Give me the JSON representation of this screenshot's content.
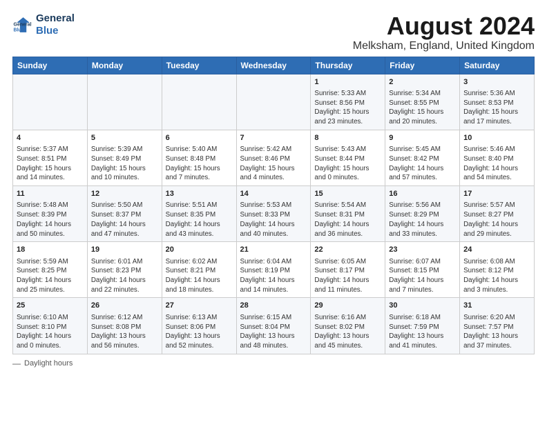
{
  "header": {
    "logo_line1": "General",
    "logo_line2": "Blue",
    "main_title": "August 2024",
    "subtitle": "Melksham, England, United Kingdom"
  },
  "columns": [
    "Sunday",
    "Monday",
    "Tuesday",
    "Wednesday",
    "Thursday",
    "Friday",
    "Saturday"
  ],
  "weeks": [
    [
      {
        "day": "",
        "content": ""
      },
      {
        "day": "",
        "content": ""
      },
      {
        "day": "",
        "content": ""
      },
      {
        "day": "",
        "content": ""
      },
      {
        "day": "1",
        "content": "Sunrise: 5:33 AM\nSunset: 8:56 PM\nDaylight: 15 hours\nand 23 minutes."
      },
      {
        "day": "2",
        "content": "Sunrise: 5:34 AM\nSunset: 8:55 PM\nDaylight: 15 hours\nand 20 minutes."
      },
      {
        "day": "3",
        "content": "Sunrise: 5:36 AM\nSunset: 8:53 PM\nDaylight: 15 hours\nand 17 minutes."
      }
    ],
    [
      {
        "day": "4",
        "content": "Sunrise: 5:37 AM\nSunset: 8:51 PM\nDaylight: 15 hours\nand 14 minutes."
      },
      {
        "day": "5",
        "content": "Sunrise: 5:39 AM\nSunset: 8:49 PM\nDaylight: 15 hours\nand 10 minutes."
      },
      {
        "day": "6",
        "content": "Sunrise: 5:40 AM\nSunset: 8:48 PM\nDaylight: 15 hours\nand 7 minutes."
      },
      {
        "day": "7",
        "content": "Sunrise: 5:42 AM\nSunset: 8:46 PM\nDaylight: 15 hours\nand 4 minutes."
      },
      {
        "day": "8",
        "content": "Sunrise: 5:43 AM\nSunset: 8:44 PM\nDaylight: 15 hours\nand 0 minutes."
      },
      {
        "day": "9",
        "content": "Sunrise: 5:45 AM\nSunset: 8:42 PM\nDaylight: 14 hours\nand 57 minutes."
      },
      {
        "day": "10",
        "content": "Sunrise: 5:46 AM\nSunset: 8:40 PM\nDaylight: 14 hours\nand 54 minutes."
      }
    ],
    [
      {
        "day": "11",
        "content": "Sunrise: 5:48 AM\nSunset: 8:39 PM\nDaylight: 14 hours\nand 50 minutes."
      },
      {
        "day": "12",
        "content": "Sunrise: 5:50 AM\nSunset: 8:37 PM\nDaylight: 14 hours\nand 47 minutes."
      },
      {
        "day": "13",
        "content": "Sunrise: 5:51 AM\nSunset: 8:35 PM\nDaylight: 14 hours\nand 43 minutes."
      },
      {
        "day": "14",
        "content": "Sunrise: 5:53 AM\nSunset: 8:33 PM\nDaylight: 14 hours\nand 40 minutes."
      },
      {
        "day": "15",
        "content": "Sunrise: 5:54 AM\nSunset: 8:31 PM\nDaylight: 14 hours\nand 36 minutes."
      },
      {
        "day": "16",
        "content": "Sunrise: 5:56 AM\nSunset: 8:29 PM\nDaylight: 14 hours\nand 33 minutes."
      },
      {
        "day": "17",
        "content": "Sunrise: 5:57 AM\nSunset: 8:27 PM\nDaylight: 14 hours\nand 29 minutes."
      }
    ],
    [
      {
        "day": "18",
        "content": "Sunrise: 5:59 AM\nSunset: 8:25 PM\nDaylight: 14 hours\nand 25 minutes."
      },
      {
        "day": "19",
        "content": "Sunrise: 6:01 AM\nSunset: 8:23 PM\nDaylight: 14 hours\nand 22 minutes."
      },
      {
        "day": "20",
        "content": "Sunrise: 6:02 AM\nSunset: 8:21 PM\nDaylight: 14 hours\nand 18 minutes."
      },
      {
        "day": "21",
        "content": "Sunrise: 6:04 AM\nSunset: 8:19 PM\nDaylight: 14 hours\nand 14 minutes."
      },
      {
        "day": "22",
        "content": "Sunrise: 6:05 AM\nSunset: 8:17 PM\nDaylight: 14 hours\nand 11 minutes."
      },
      {
        "day": "23",
        "content": "Sunrise: 6:07 AM\nSunset: 8:15 PM\nDaylight: 14 hours\nand 7 minutes."
      },
      {
        "day": "24",
        "content": "Sunrise: 6:08 AM\nSunset: 8:12 PM\nDaylight: 14 hours\nand 3 minutes."
      }
    ],
    [
      {
        "day": "25",
        "content": "Sunrise: 6:10 AM\nSunset: 8:10 PM\nDaylight: 14 hours\nand 0 minutes."
      },
      {
        "day": "26",
        "content": "Sunrise: 6:12 AM\nSunset: 8:08 PM\nDaylight: 13 hours\nand 56 minutes."
      },
      {
        "day": "27",
        "content": "Sunrise: 6:13 AM\nSunset: 8:06 PM\nDaylight: 13 hours\nand 52 minutes."
      },
      {
        "day": "28",
        "content": "Sunrise: 6:15 AM\nSunset: 8:04 PM\nDaylight: 13 hours\nand 48 minutes."
      },
      {
        "day": "29",
        "content": "Sunrise: 6:16 AM\nSunset: 8:02 PM\nDaylight: 13 hours\nand 45 minutes."
      },
      {
        "day": "30",
        "content": "Sunrise: 6:18 AM\nSunset: 7:59 PM\nDaylight: 13 hours\nand 41 minutes."
      },
      {
        "day": "31",
        "content": "Sunrise: 6:20 AM\nSunset: 7:57 PM\nDaylight: 13 hours\nand 37 minutes."
      }
    ]
  ],
  "legend": {
    "daylight_label": "Daylight hours"
  }
}
